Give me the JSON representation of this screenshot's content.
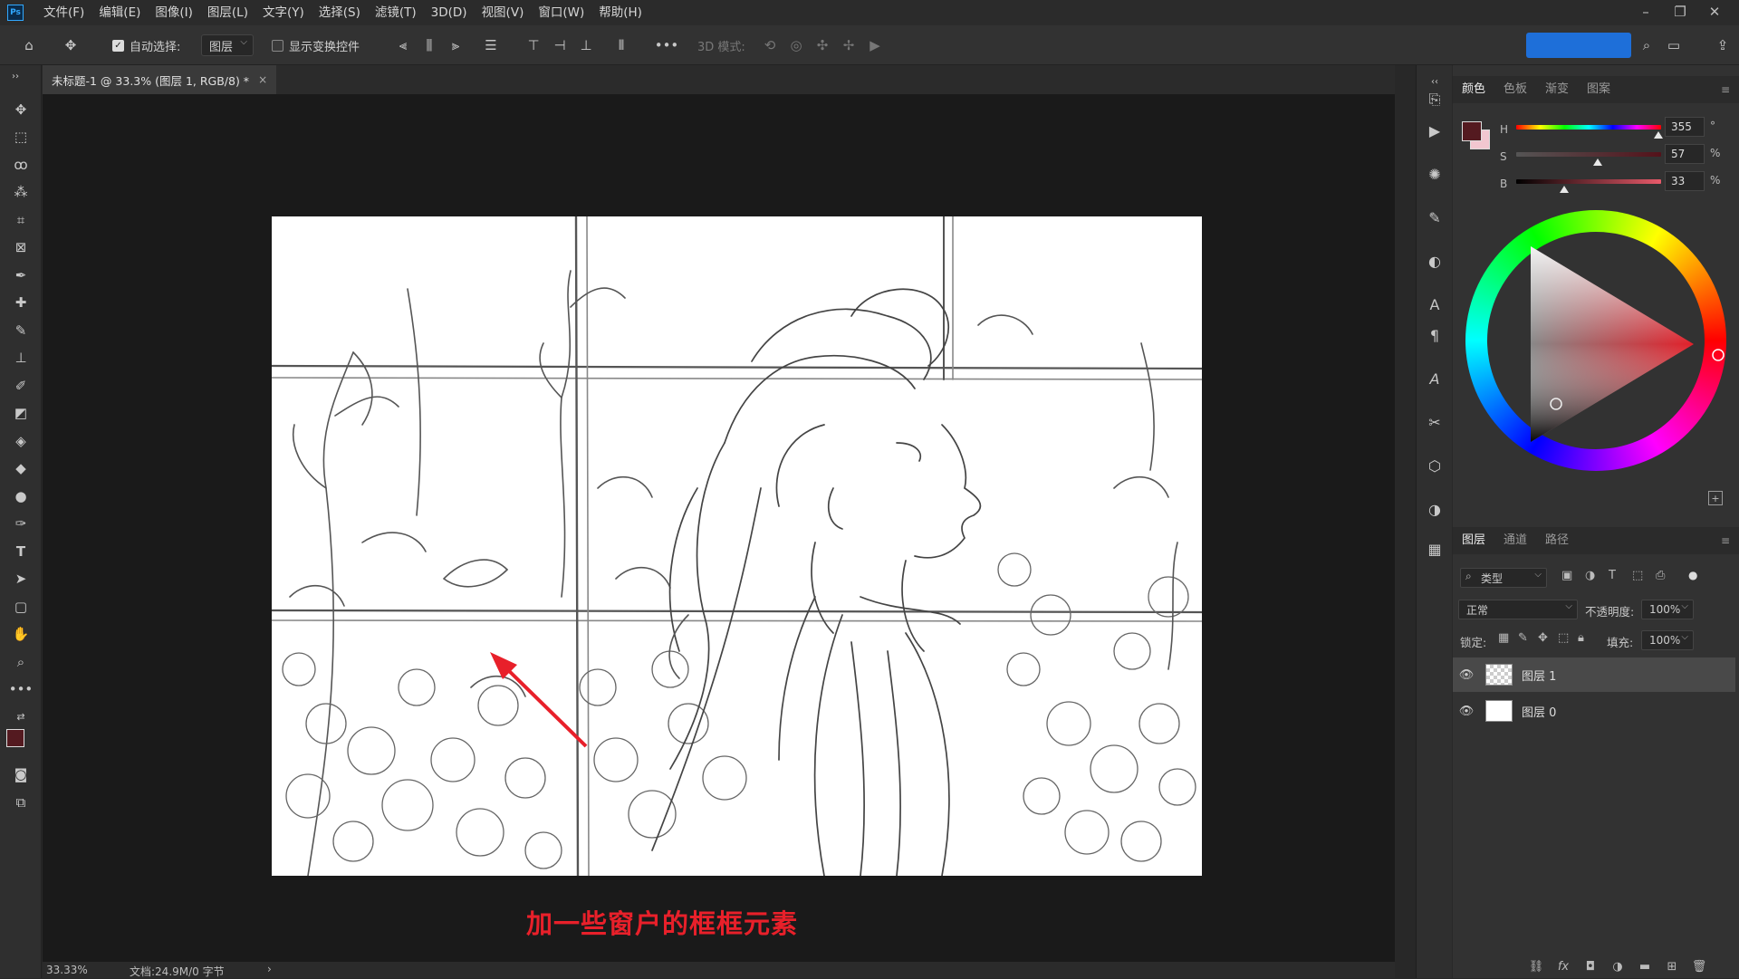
{
  "app": {
    "logo": "Ps",
    "menu": [
      "文件(F)",
      "编辑(E)",
      "图像(I)",
      "图层(L)",
      "文字(Y)",
      "选择(S)",
      "滤镜(T)",
      "3D(D)",
      "视图(V)",
      "窗口(W)",
      "帮助(H)"
    ]
  },
  "options_bar": {
    "auto_select_label": "自动选择:",
    "auto_select_checked": true,
    "auto_select_target": "图层",
    "show_transform_label": "显示变换控件",
    "show_transform_checked": false,
    "more_label": "•••",
    "mode_3d_label": "3D 模式:"
  },
  "document": {
    "tab_title": "未标题-1 @ 33.3% (图层 1, RGB/8) *",
    "tab_close": "×",
    "zoom": "33.33%",
    "doc_info": "文档:24.9M/0 字节",
    "status_arrow": "›"
  },
  "annotation": {
    "text": "加一些窗户的框框元素",
    "color": "#e8202a"
  },
  "color_panel": {
    "tabs": [
      "颜色",
      "色板",
      "渐变",
      "图案"
    ],
    "active_tab": 0,
    "h": {
      "label": "H",
      "value": "355",
      "unit": "°"
    },
    "s": {
      "label": "S",
      "value": "57",
      "unit": "%"
    },
    "b": {
      "label": "B",
      "value": "33",
      "unit": "%"
    },
    "foreground": "#541a20",
    "background": "#f2c7d0"
  },
  "layers_panel": {
    "tabs": [
      "图层",
      "通道",
      "路径"
    ],
    "active_tab": 0,
    "filter_label": "类型",
    "blend_mode": "正常",
    "opacity_label": "不透明度:",
    "opacity": "100%",
    "lock_label": "锁定:",
    "fill_label": "填充:",
    "fill": "100%",
    "layers": [
      {
        "name": "图层 1",
        "selected": true,
        "visible": true
      },
      {
        "name": "图层 0",
        "selected": false,
        "visible": true
      }
    ]
  }
}
